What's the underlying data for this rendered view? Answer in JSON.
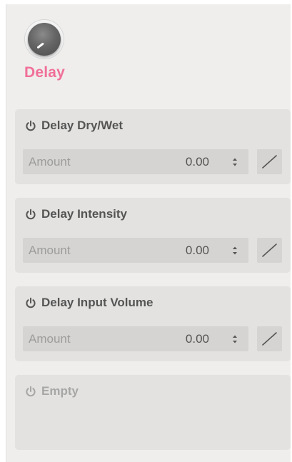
{
  "device": {
    "title": "Delay",
    "title_color": "#f16f9a",
    "knob_icon": "knob-icon"
  },
  "params": [
    {
      "title": "Delay Dry/Wet",
      "amount_label": "Amount",
      "value": "0.00",
      "enabled": true
    },
    {
      "title": "Delay Intensity",
      "amount_label": "Amount",
      "value": "0.00",
      "enabled": true
    },
    {
      "title": "Delay Input Volume",
      "amount_label": "Amount",
      "value": "0.00",
      "enabled": true
    },
    {
      "title": "Empty",
      "enabled": false
    }
  ],
  "icons": {
    "power": "power-icon",
    "stepper": "stepper-icon",
    "curve": "linear-curve-icon"
  }
}
